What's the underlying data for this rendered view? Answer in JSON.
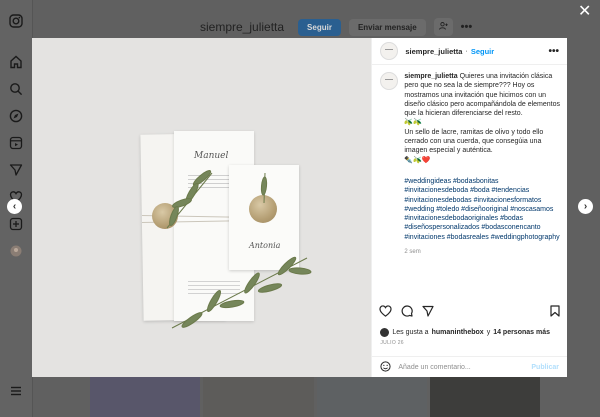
{
  "profile_header": {
    "username": "siempre_julietta",
    "follow_label": "Seguir",
    "message_label": "Enviar mensaje",
    "more_label": "•••"
  },
  "sidebar_icons": [
    "instagram-icon",
    "home-icon",
    "search-icon",
    "explore-icon",
    "reels-icon",
    "messages-icon",
    "notifications-icon",
    "create-icon",
    "profile-avatar",
    "menu-icon"
  ],
  "post": {
    "username": "siempre_julietta",
    "follow_label": "Seguir",
    "more_label": "•••",
    "caption_text": "Quieres una invitación clásica pero que no sea la de siempre??? Hoy os mostramos una invitación que hicimos con un diseño clásico pero acompañándola de elementos que la hicieran diferenciarse del resto.",
    "emoji_line_1": "🫒🫒",
    "caption_text_2": "Un sello de lacre, ramitas de olivo y todo ello cerrado con una cuerda, que consegúia una imagen especial y auténtica.",
    "emoji_line_2": "✒️🫒❤️",
    "hashtags": "#weddingideas #bodasbonitas #invitacionesdeboda #boda #tendencias #invitacionesdebodas #invitacionesformatos #wedding #toledo #diseñooriginal #noscasamos #invitacionesdebodaoriginales #bodas #diseñospersonalizados #bodasconencanto #invitaciones #bodasreales #weddingphotography",
    "time_ago": "2 sem",
    "likes_prefix": "Les gusta a",
    "likes_user": "humaninthebox",
    "likes_conj": "y",
    "likes_others": "14 personas más",
    "date": "JULIO 26",
    "comment_placeholder": "Añade un comentario...",
    "post_label": "Publicar"
  },
  "photo": {
    "card_left_name": "Manuel",
    "card_right_name": "Antonia"
  },
  "colors": {
    "accent": "#0095f6",
    "hashtag": "#00376b",
    "overlay": "#606060"
  }
}
